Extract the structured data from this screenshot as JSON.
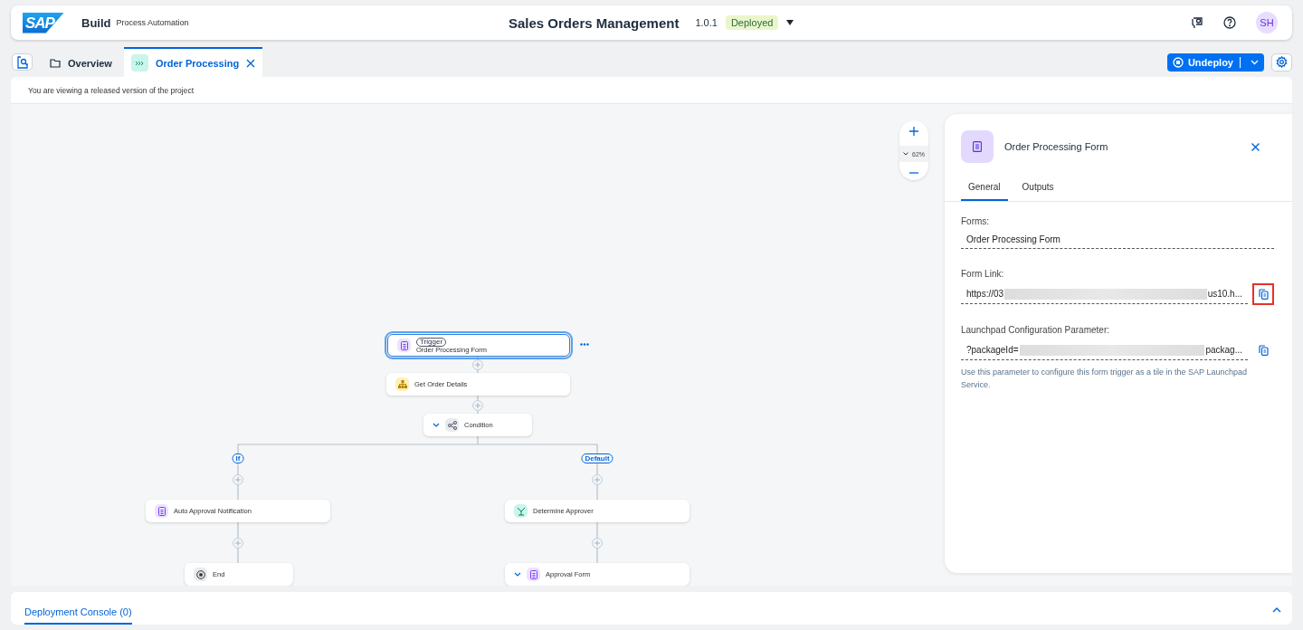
{
  "header": {
    "logo": "SAP",
    "product": "Build",
    "subtitle": "Process Automation",
    "title": "Sales Orders Management",
    "version": "1.0.1",
    "status": "Deployed",
    "avatar": "SH"
  },
  "tabs": [
    {
      "label": "Overview",
      "kind": "overview",
      "selected": false,
      "closable": false
    },
    {
      "label": "Order Processing",
      "kind": "process",
      "selected": true,
      "closable": true
    }
  ],
  "actions": {
    "primary": "Undeploy"
  },
  "info": "You are viewing a released version of the project",
  "zoom": {
    "level_text": "62%"
  },
  "nodes": [
    {
      "kind": "form",
      "badge": "Trigger",
      "label": "Order Processing Form",
      "selected": true,
      "collapsible": false
    },
    {
      "kind": "data",
      "label": "Get Order Details",
      "selected": false,
      "collapsible": false
    },
    {
      "kind": "condition",
      "label": "Condition",
      "selected": false,
      "collapsible": true
    },
    {
      "kind": "form",
      "label": "Auto Approval Notification",
      "selected": false,
      "collapsible": false
    },
    {
      "kind": "decision",
      "label": "Determine Approver",
      "selected": false,
      "collapsible": false
    },
    {
      "kind": "end",
      "label": "End",
      "selected": false,
      "collapsible": false
    },
    {
      "kind": "form",
      "label": "Approval Form",
      "selected": false,
      "collapsible": true
    }
  ],
  "branches": [
    "If",
    "Default"
  ],
  "panel": {
    "title": "Order Processing Form",
    "tabs": [
      {
        "label": "General",
        "selected": true
      },
      {
        "label": "Outputs",
        "selected": false
      }
    ],
    "fields": [
      {
        "label": "Forms:",
        "value": "Order Processing Form"
      },
      {
        "label": "Form Link:",
        "value": "https://03",
        "value_end": "us10.h...",
        "redacted": true,
        "copy": true,
        "highlighted": true
      },
      {
        "label": "Launchpad Configuration Parameter:",
        "value": "?packageId=",
        "value_end": "packag...",
        "redacted": true,
        "copy": true,
        "highlighted": false,
        "hint": "Use this parameter to configure this form trigger as a tile in the SAP Launchpad Service."
      }
    ]
  },
  "console": {
    "label": "Deployment Console (0)",
    "expanded": false
  }
}
